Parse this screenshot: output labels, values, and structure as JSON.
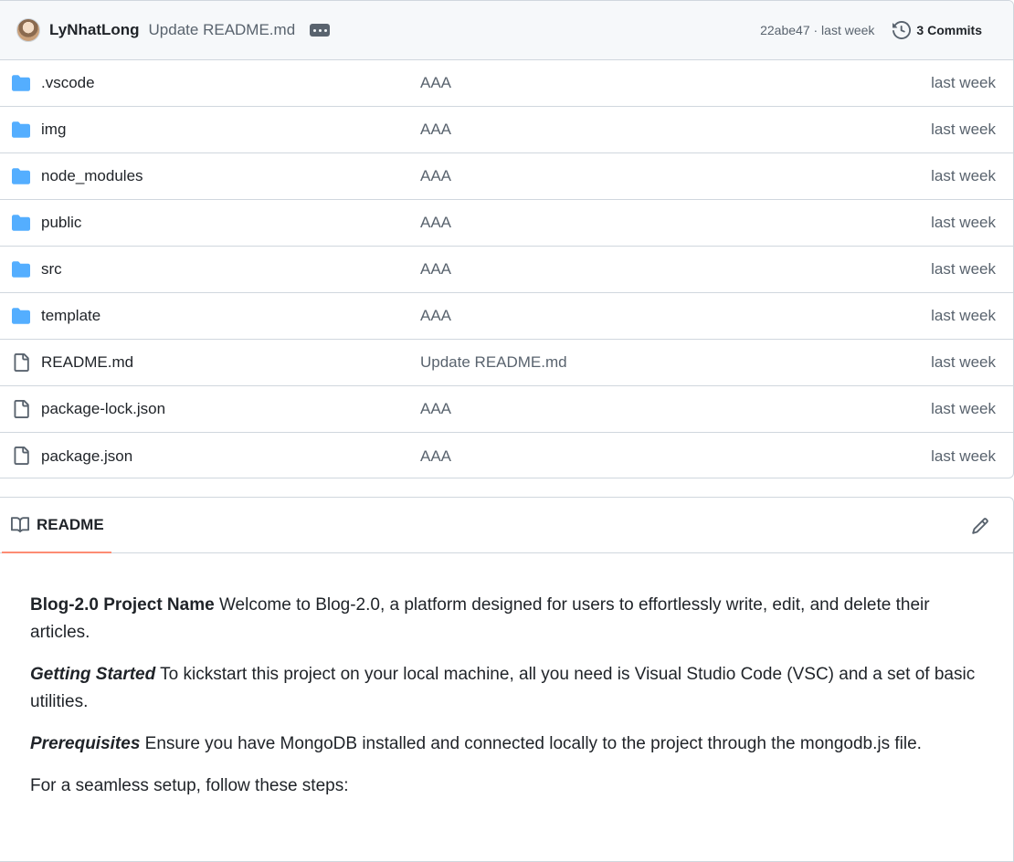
{
  "commit": {
    "author": "LyNhatLong",
    "message": "Update README.md",
    "sha_meta": "22abe47 · last week",
    "commits_label": "3 Commits"
  },
  "files": [
    {
      "name": ".vscode",
      "type": "folder",
      "message": "AAA",
      "date": "last week"
    },
    {
      "name": "img",
      "type": "folder",
      "message": "AAA",
      "date": "last week"
    },
    {
      "name": "node_modules",
      "type": "folder",
      "message": "AAA",
      "date": "last week"
    },
    {
      "name": "public",
      "type": "folder",
      "message": "AAA",
      "date": "last week"
    },
    {
      "name": "src",
      "type": "folder",
      "message": "AAA",
      "date": "last week"
    },
    {
      "name": "template",
      "type": "folder",
      "message": "AAA",
      "date": "last week"
    },
    {
      "name": "README.md",
      "type": "file",
      "message": "Update README.md",
      "date": "last week"
    },
    {
      "name": "package-lock.json",
      "type": "file",
      "message": "AAA",
      "date": "last week"
    },
    {
      "name": "package.json",
      "type": "file",
      "message": "AAA",
      "date": "last week"
    }
  ],
  "readme": {
    "tab_label": "README",
    "p1_bold": "Blog-2.0 Project Name",
    "p1_text": " Welcome to Blog-2.0, a platform designed for users to effortlessly write, edit, and delete their articles.",
    "p2_em": "Getting Started",
    "p2_text": " To kickstart this project on your local machine, all you need is Visual Studio Code (VSC) and a set of basic utilities.",
    "p3_em": "Prerequisites",
    "p3_text": " Ensure you have MongoDB installed and connected locally to the project through the mongodb.js file.",
    "p4_text": "For a seamless setup, follow these steps:"
  },
  "colors": {
    "folder": "#54aeff",
    "file": "#59636e",
    "tab_underline": "#fd8c73"
  },
  "icons": {
    "folder": "folder-icon",
    "file": "file-icon",
    "history": "history-icon",
    "book": "book-icon",
    "pencil": "pencil-icon"
  }
}
